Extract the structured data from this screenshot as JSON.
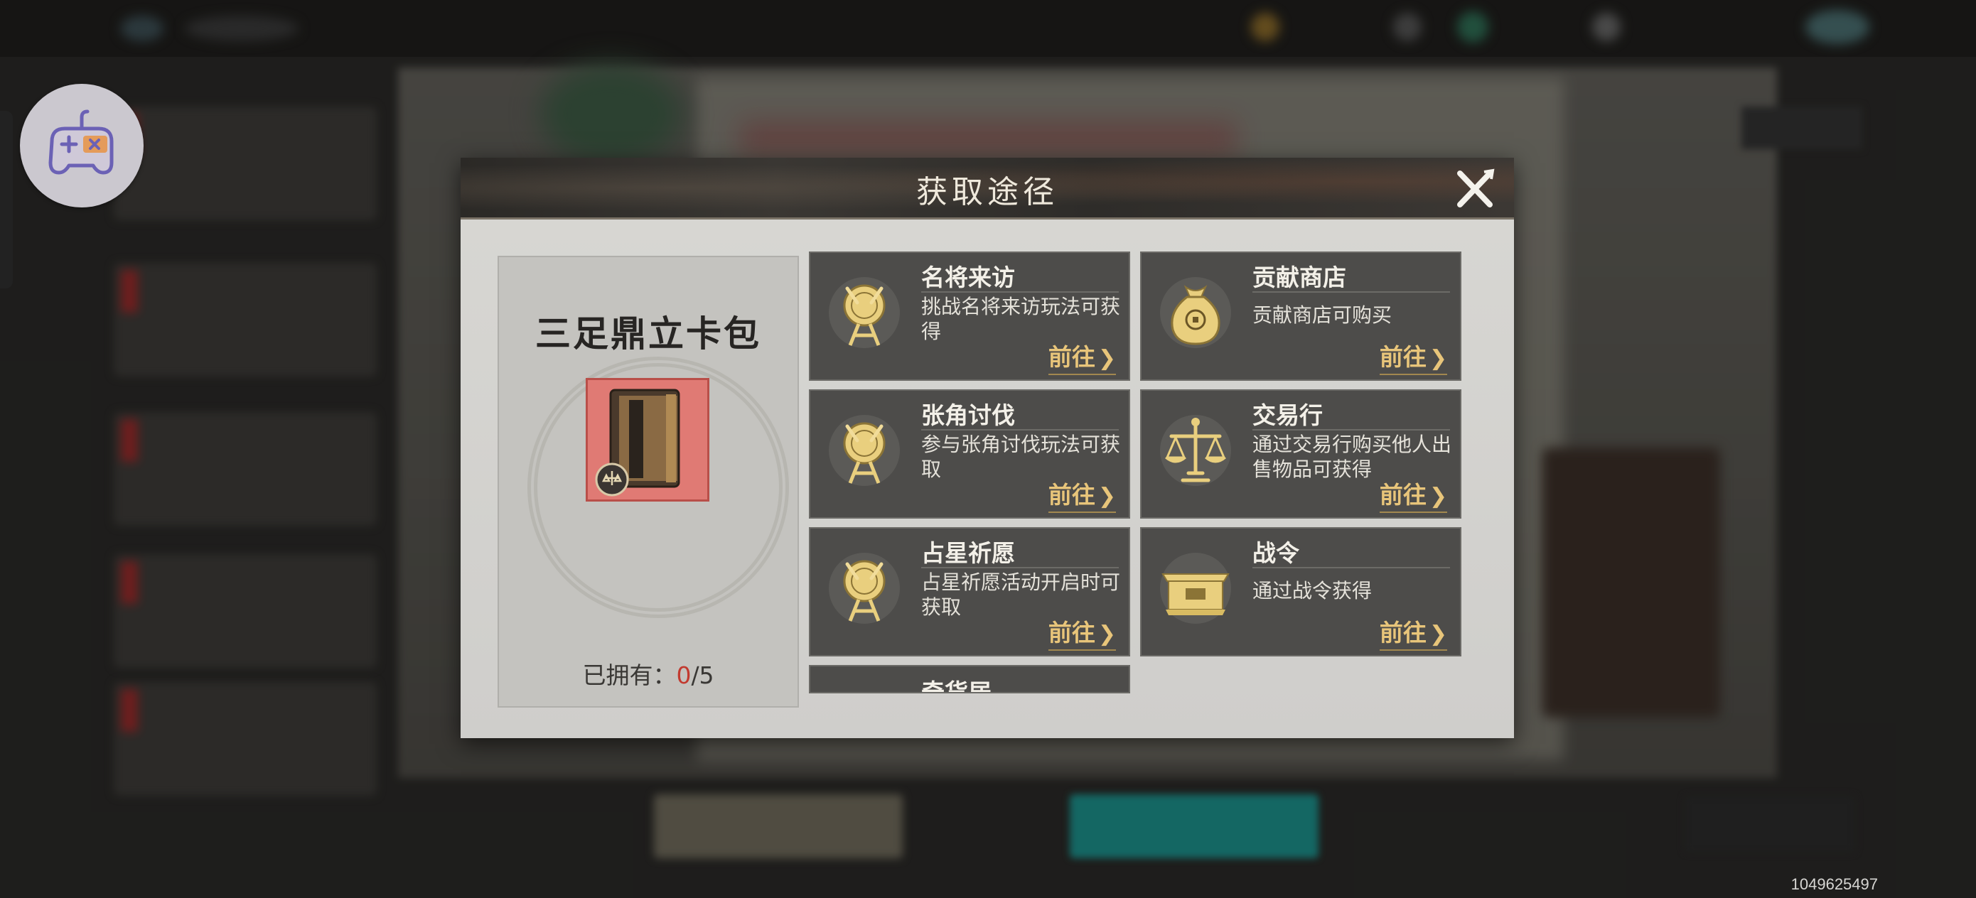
{
  "dialog": {
    "title": "获取途径",
    "close_label": "close"
  },
  "item": {
    "name": "三足鼎立卡包",
    "owned_label": "已拥有：",
    "owned_current": "0",
    "owned_total": "/5"
  },
  "sources": [
    {
      "name": "名将来访",
      "desc": "挑战名将来访玩法可获得",
      "action": "前往",
      "icon": "drum-icon"
    },
    {
      "name": "贡献商店",
      "desc": "贡献商店可购买",
      "action": "前往",
      "icon": "money-bag-icon"
    },
    {
      "name": "张角讨伐",
      "desc": "参与张角讨伐玩法可获取",
      "action": "前往",
      "icon": "drum-icon"
    },
    {
      "name": "交易行",
      "desc": "通过交易行购买他人出售物品可获得",
      "action": "前往",
      "icon": "scales-icon"
    },
    {
      "name": "占星祈愿",
      "desc": "占星祈愿活动开启时可获取",
      "action": "前往",
      "icon": "drum-icon"
    },
    {
      "name": "战令",
      "desc": "通过战令获得",
      "action": "前往",
      "icon": "chest-icon"
    },
    {
      "name": "奇货居"
    }
  ],
  "footer": {
    "uid": "1049625497"
  },
  "colors": {
    "accent_gold": "#e8c57a",
    "owned_red": "#c23a2f",
    "card_bg": "#4d4c4a"
  }
}
